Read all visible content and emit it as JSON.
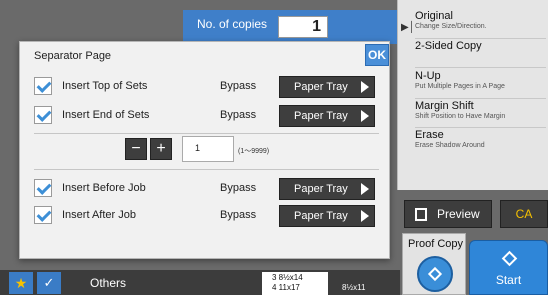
{
  "header": {
    "copies_label": "No. of copies",
    "copies_value": "1"
  },
  "right_panel": {
    "items": [
      {
        "title": "Original",
        "subtitle": "Change Size/Direction."
      },
      {
        "title": "2-Sided Copy",
        "subtitle": ""
      },
      {
        "title": "N-Up",
        "subtitle": "Put Multiple Pages in A Page"
      },
      {
        "title": "Margin Shift",
        "subtitle": "Shift Position to Have Margin"
      },
      {
        "title": "Erase",
        "subtitle": "Erase Shadow Around"
      }
    ]
  },
  "buttons": {
    "preview": "Preview",
    "ca": "CA",
    "proof_copy": "Proof Copy",
    "start": "Start",
    "others": "Others"
  },
  "tray_list": {
    "line1": "3  8½x14",
    "line2": "4   11x17",
    "badge": "8½x11"
  },
  "dialog": {
    "title": "Separator Page",
    "ok": "OK",
    "rows": [
      {
        "label": "Insert Top of Sets",
        "bypass": "Bypass",
        "tray": "Paper Tray",
        "checked": true
      },
      {
        "label": "Insert End of Sets",
        "bypass": "Bypass",
        "tray": "Paper Tray",
        "checked": true
      },
      {
        "label": "Insert Before Job",
        "bypass": "Bypass",
        "tray": "Paper Tray",
        "checked": true
      },
      {
        "label": "Insert After Job",
        "bypass": "Bypass",
        "tray": "Paper Tray",
        "checked": true
      }
    ],
    "stepper": {
      "minus": "−",
      "plus": "+",
      "value": "1",
      "range": "(1～9999)"
    }
  },
  "colors": {
    "accent": "#3d8fd6",
    "star": "#f7c200"
  }
}
